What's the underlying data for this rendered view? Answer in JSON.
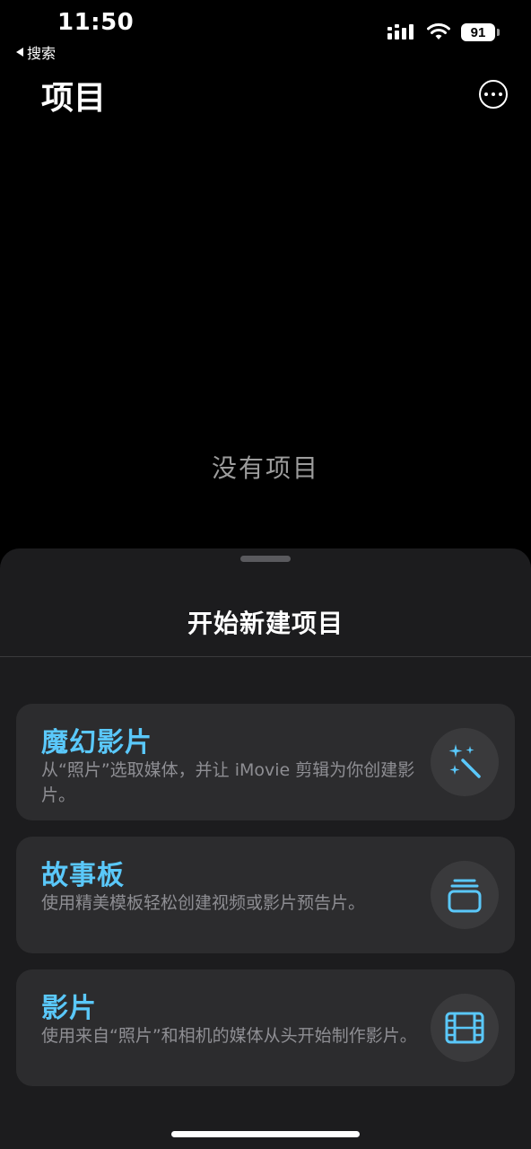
{
  "status_bar": {
    "time": "11:50",
    "back_label": "搜索",
    "battery": "91"
  },
  "header": {
    "title": "项目"
  },
  "main": {
    "empty_text": "没有项目"
  },
  "sheet": {
    "title": "开始新建项目",
    "options": [
      {
        "title": "魔幻影片",
        "description": "从“照片”选取媒体，并让 iMovie 剪辑为你创建影片。",
        "icon": "magic-wand-icon"
      },
      {
        "title": "故事板",
        "description": "使用精美模板轻松创建视频或影片预告片。",
        "icon": "storyboard-stack-icon"
      },
      {
        "title": "影片",
        "description": "使用来自“照片”和相机的媒体从头开始制作影片。",
        "icon": "film-strip-icon"
      }
    ]
  },
  "colors": {
    "accent": "#5ac8fa",
    "background": "#000000",
    "sheet": "#1c1c1e",
    "card": "#2c2c2e"
  }
}
